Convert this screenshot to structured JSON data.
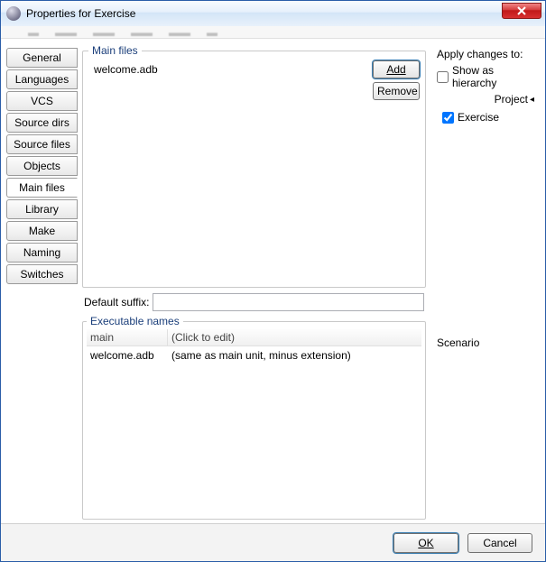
{
  "window": {
    "title": "Properties for Exercise"
  },
  "tabs": [
    "General",
    "Languages",
    "VCS",
    "Source dirs",
    "Source files",
    "Objects",
    "Main files",
    "Library",
    "Make",
    "Naming",
    "Switches"
  ],
  "active_tab_index": 6,
  "main_files": {
    "legend": "Main files",
    "items": [
      "welcome.adb"
    ],
    "add_label": "Add",
    "remove_label": "Remove"
  },
  "default_suffix": {
    "label": "Default suffix:",
    "value": ""
  },
  "exec_names": {
    "legend": "Executable names",
    "header": {
      "col1": "main",
      "col2": "(Click to edit)"
    },
    "rows": [
      {
        "col1": "welcome.adb",
        "col2": "(same as main unit, minus extension)"
      }
    ]
  },
  "apply": {
    "header": "Apply changes to:",
    "show_hierarchy_label": "Show as hierarchy",
    "show_hierarchy_checked": false,
    "project_label": "Project",
    "tree_item_label": "Exercise",
    "tree_item_checked": true,
    "scenario_label": "Scenario"
  },
  "footer": {
    "ok": "OK",
    "cancel": "Cancel"
  }
}
